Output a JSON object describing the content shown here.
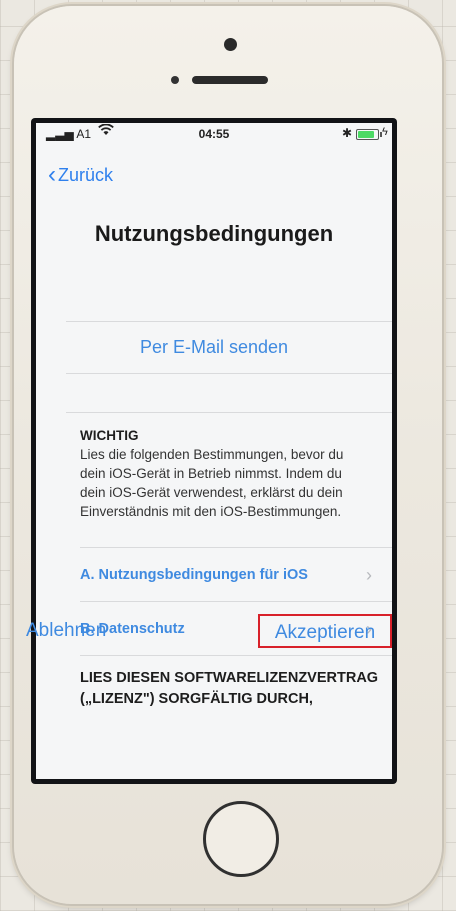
{
  "status_bar": {
    "carrier": "A1",
    "time": "04:55",
    "wifi_icon": "wifi-icon",
    "bluetooth_icon": "bluetooth-icon",
    "battery_level": 0.85,
    "battery_color": "#4cd964"
  },
  "nav": {
    "back_label": "Zurück"
  },
  "page": {
    "title": "Nutzungsbedingungen",
    "email_link": "Per E-Mail senden"
  },
  "important": {
    "heading": "WICHTIG",
    "body": "Lies die folgenden Bestimmungen, bevor du dein iOS-Gerät in Betrieb nimmst. Indem du dein iOS-Gerät verwendest, erklärst du dein Einverständnis mit den iOS-Bestimmungen."
  },
  "links": [
    {
      "label": "A. Nutzungsbedingungen für iOS"
    },
    {
      "label": "B. Datenschutz"
    }
  ],
  "license": {
    "text": "LIES DIESEN SOFTWARELIZENZVERTRAG („LIZENZ\") SORGFÄLTIG DURCH,"
  },
  "actions": {
    "decline_label": "Ablehnen",
    "accept_label": "Akzeptieren",
    "accept_highlight_color": "#d8212a"
  },
  "colors": {
    "accent": "#3f8ae0"
  }
}
